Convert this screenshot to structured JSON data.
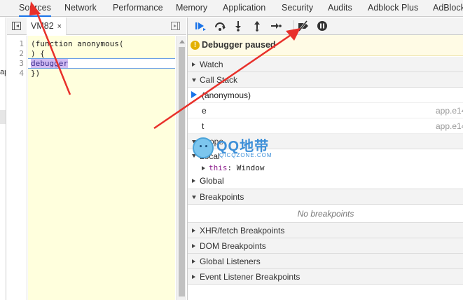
{
  "tabs": [
    {
      "label": "Sources",
      "active": true
    },
    {
      "label": "Network"
    },
    {
      "label": "Performance"
    },
    {
      "label": "Memory"
    },
    {
      "label": "Application"
    },
    {
      "label": "Security"
    },
    {
      "label": "Audits"
    },
    {
      "label": "Adblock Plus"
    },
    {
      "label": "AdBlock"
    }
  ],
  "navigator": {
    "fragment": "ap"
  },
  "editor": {
    "file_tab": "VM82",
    "close_glyph": "×",
    "lines": [
      {
        "no": "1",
        "text": "(function anonymous("
      },
      {
        "no": "2",
        "text": ") {"
      },
      {
        "no": "3",
        "text": "debugger",
        "paused": true
      },
      {
        "no": "4",
        "text": "})"
      }
    ]
  },
  "debugger": {
    "toolbar_icons": [
      "resume-icon",
      "step-over-icon",
      "step-into-icon",
      "step-out-icon",
      "step-icon",
      "deactivate-breakpoints-icon",
      "pause-on-exceptions-icon"
    ],
    "paused_banner": "Debugger paused",
    "sections": {
      "watch": "Watch",
      "call_stack": "Call Stack",
      "scope": "Scope",
      "breakpoints": "Breakpoints",
      "xhr": "XHR/fetch Breakpoints",
      "dom": "DOM Breakpoints",
      "global_listeners": "Global Listeners",
      "event_listener": "Event Listener Breakpoints"
    },
    "call_stack": [
      {
        "name": "(anonymous)",
        "location": "",
        "current": true
      },
      {
        "name": "e",
        "location": "app.e14"
      },
      {
        "name": "t",
        "location": "app.e14"
      }
    ],
    "scope": {
      "local": "Local",
      "this_key": "this",
      "this_value": ": Window",
      "global": "Global"
    },
    "no_breakpoints": "No breakpoints"
  },
  "watermark": {
    "big": "QQ地带",
    "small": "QICQZONE.COM"
  },
  "colors": {
    "accent": "#1a73e8",
    "annotation": "#e8302a",
    "paused_line": "#d0bbf3",
    "editor_bg": "#ffffdd"
  }
}
